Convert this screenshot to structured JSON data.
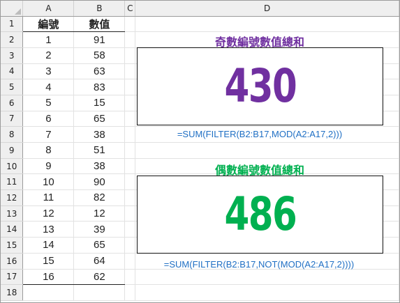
{
  "columns": [
    "A",
    "B",
    "C",
    "D"
  ],
  "rows": [
    "1",
    "2",
    "3",
    "4",
    "5",
    "6",
    "7",
    "8",
    "9",
    "10",
    "11",
    "12",
    "13",
    "14",
    "15",
    "16",
    "17",
    "18"
  ],
  "table": {
    "header": {
      "a": "編號",
      "b": "數值"
    },
    "records": [
      {
        "a": "1",
        "b": "91"
      },
      {
        "a": "2",
        "b": "58"
      },
      {
        "a": "3",
        "b": "63"
      },
      {
        "a": "4",
        "b": "83"
      },
      {
        "a": "5",
        "b": "15"
      },
      {
        "a": "6",
        "b": "65"
      },
      {
        "a": "7",
        "b": "38"
      },
      {
        "a": "8",
        "b": "51"
      },
      {
        "a": "9",
        "b": "38"
      },
      {
        "a": "10",
        "b": "90"
      },
      {
        "a": "11",
        "b": "82"
      },
      {
        "a": "12",
        "b": "12"
      },
      {
        "a": "13",
        "b": "39"
      },
      {
        "a": "14",
        "b": "65"
      },
      {
        "a": "15",
        "b": "64"
      },
      {
        "a": "16",
        "b": "62"
      }
    ]
  },
  "odd_panel": {
    "title": "奇數編號數值總和",
    "value": "430",
    "formula": "=SUM(FILTER(B2:B17,MOD(A2:A17,2)))",
    "color": "#7030a0"
  },
  "even_panel": {
    "title": "偶數編號數值總和",
    "value": "486",
    "formula": "=SUM(FILTER(B2:B17,NOT(MOD(A2:A17,2))))",
    "color": "#00b050"
  },
  "colors": {
    "formula": "#1f6fc4",
    "header_bg": "#efefef",
    "grid": "#e2e2e2"
  }
}
